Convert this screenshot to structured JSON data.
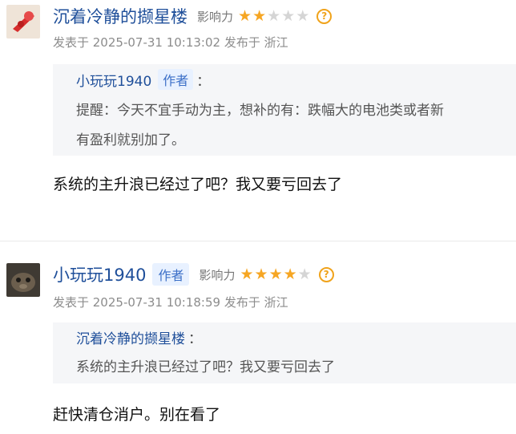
{
  "comments": [
    {
      "username": "沉着冷静的撷星楼",
      "influence_label": "影响力",
      "rating": 2,
      "rating_max": 5,
      "meta": "发表于 2025-07-31 10:13:02 发布于 浙江",
      "quote": {
        "name": "小玩玩1940",
        "tag": "作者",
        "colon": "：",
        "text": "提醒：今天不宜手动为主，想补的有：跌幅大的电池类或者新\n有盈利就别加了。"
      },
      "body": "系统的主升浪已经过了吧？我又要亏回去了",
      "colors": {
        "avatar_bg": "#efe4d8",
        "avatar_accent": "#d72d2d"
      }
    },
    {
      "username": "小玩玩1940",
      "author_tag": "作者",
      "influence_label": "影响力",
      "rating": 4,
      "rating_max": 5,
      "meta": "发表于 2025-07-31 10:18:59 发布于 浙江",
      "quote": {
        "name": "沉着冷静的撷星楼",
        "colon": "：",
        "text": "系统的主升浪已经过了吧？我又要亏回去了"
      },
      "body": "赶快清仓消户。别在看了",
      "colors": {
        "avatar_bg": "#3f3a33",
        "avatar_accent": "#8a7b66"
      }
    }
  ],
  "icons": {
    "star": "star-icon",
    "help": "question-icon"
  },
  "colors": {
    "star_on": "#f6a623",
    "star_off": "#d5d5d5",
    "link": "#1f4f9a"
  }
}
